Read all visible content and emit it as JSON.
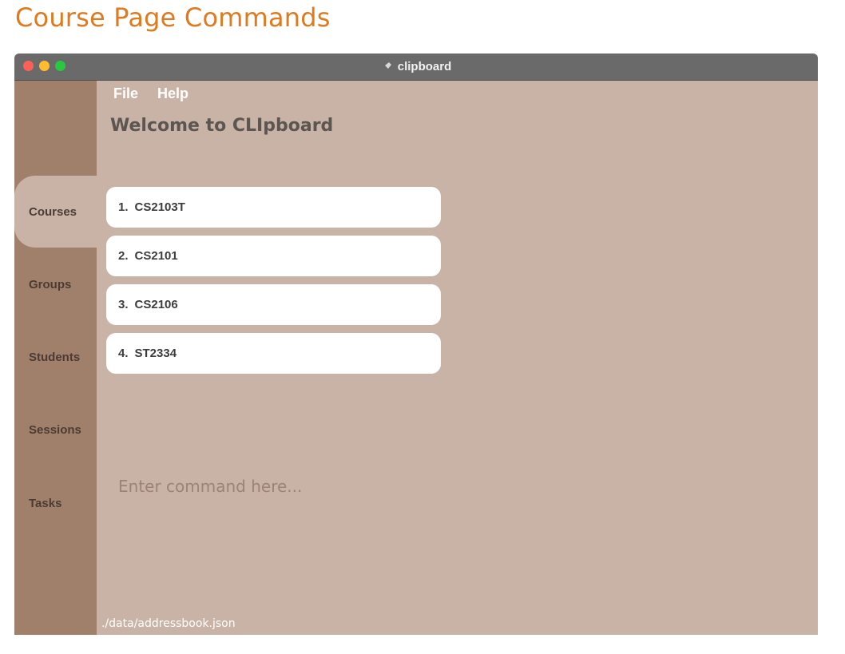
{
  "doc_heading": "Course Page Commands",
  "window": {
    "title": "clipboard",
    "app_icon": "pin-icon"
  },
  "menu": {
    "file": "File",
    "help": "Help"
  },
  "welcome": "Welcome to CLIpboard",
  "sidebar": {
    "items": [
      {
        "label": "Courses",
        "active": true
      },
      {
        "label": "Groups",
        "active": false
      },
      {
        "label": "Students",
        "active": false
      },
      {
        "label": "Sessions",
        "active": false
      },
      {
        "label": "Tasks",
        "active": false
      }
    ]
  },
  "courses": [
    {
      "index": "1.",
      "code": "CS2103T"
    },
    {
      "index": "2.",
      "code": "CS2101"
    },
    {
      "index": "3.",
      "code": "CS2106"
    },
    {
      "index": "4.",
      "code": "ST2334"
    }
  ],
  "command": {
    "placeholder": "Enter command here...",
    "value": ""
  },
  "status": {
    "path": "./data/addressbook.json"
  },
  "colors": {
    "accent": "#e07a1f",
    "sidebar": "#a0806b",
    "content": "#c9b3a6",
    "titlebar": "#6a6a6a"
  }
}
